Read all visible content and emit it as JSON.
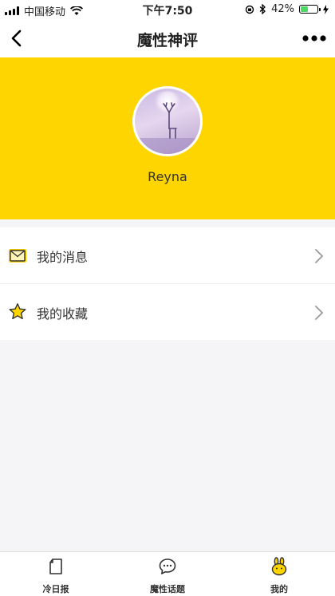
{
  "status_bar": {
    "carrier": "中国移动",
    "time": "下午7:50",
    "battery_percent": "42%",
    "battery_level": 0.42
  },
  "nav": {
    "title": "魔性神评"
  },
  "profile": {
    "username": "Reyna"
  },
  "menu": {
    "items": [
      {
        "label": "我的消息",
        "icon": "envelope-icon"
      },
      {
        "label": "我的收藏",
        "icon": "star-icon"
      }
    ]
  },
  "tabs": [
    {
      "label": "冷日报",
      "icon": "page-icon"
    },
    {
      "label": "魔性话题",
      "icon": "chat-bubble-icon"
    },
    {
      "label": "我的",
      "icon": "rabbit-icon",
      "active": true
    }
  ],
  "colors": {
    "accent": "#ffd500",
    "background": "#f5f5f7",
    "battery": "#4cd964"
  }
}
